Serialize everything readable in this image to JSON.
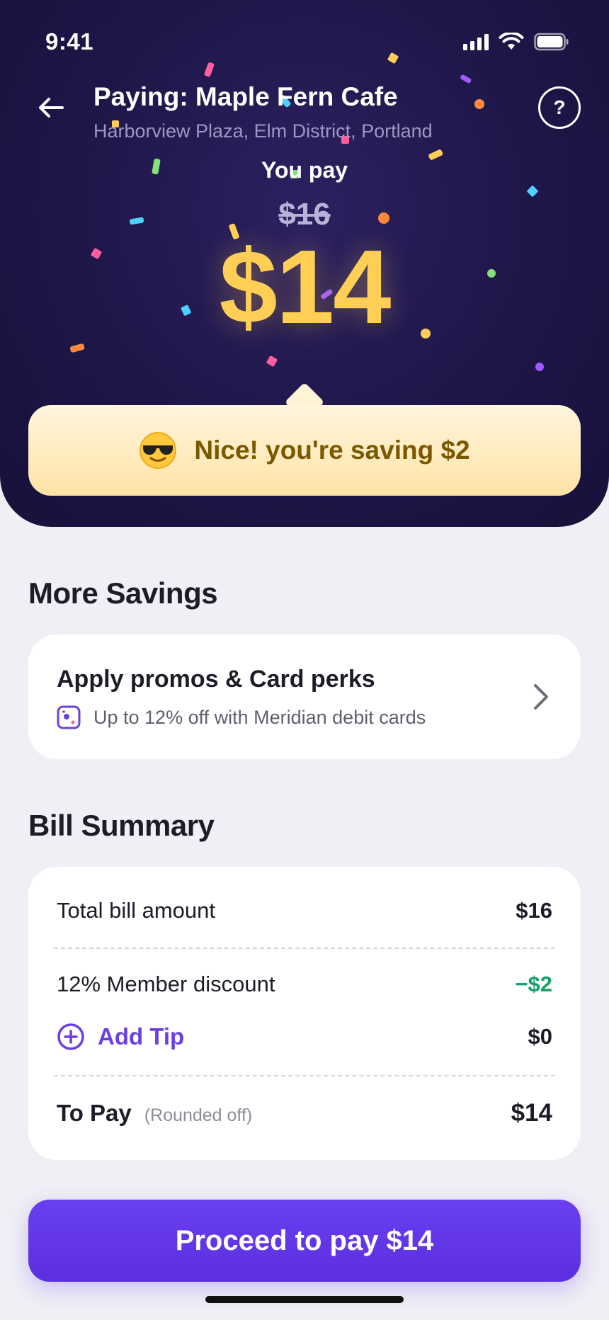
{
  "status_bar": {
    "time": "9:41"
  },
  "header": {
    "merchant_name": "Paying: Maple Fern Cafe",
    "merchant_address": "Harborview Plaza, Elm District, Portland",
    "help_label": "?"
  },
  "payment": {
    "you_pay_label": "You pay",
    "original_amount": "$16",
    "final_amount": "$14",
    "saving_message": "Nice! you're saving $2"
  },
  "more_savings": {
    "title": "More Savings",
    "promo_title": "Apply promos & Card perks",
    "promo_subtitle": "Up to 12% off with Meridian debit cards"
  },
  "bill_summary": {
    "title": "Bill Summary",
    "total_label": "Total bill amount",
    "total_value": "$16",
    "discount_label": "12% Member discount",
    "discount_value": "−$2",
    "tip_label": "Add Tip",
    "tip_value": "$0",
    "topay_label": "To Pay",
    "topay_note": "(Rounded off)",
    "topay_value": "$14"
  },
  "cta": {
    "proceed_label": "Proceed to pay $14"
  },
  "colors": {
    "hero_bg": "#1e1648",
    "accent_purple": "#6b3fe0",
    "amount_yellow": "#ffcf55",
    "discount_green": "#16a06a"
  }
}
